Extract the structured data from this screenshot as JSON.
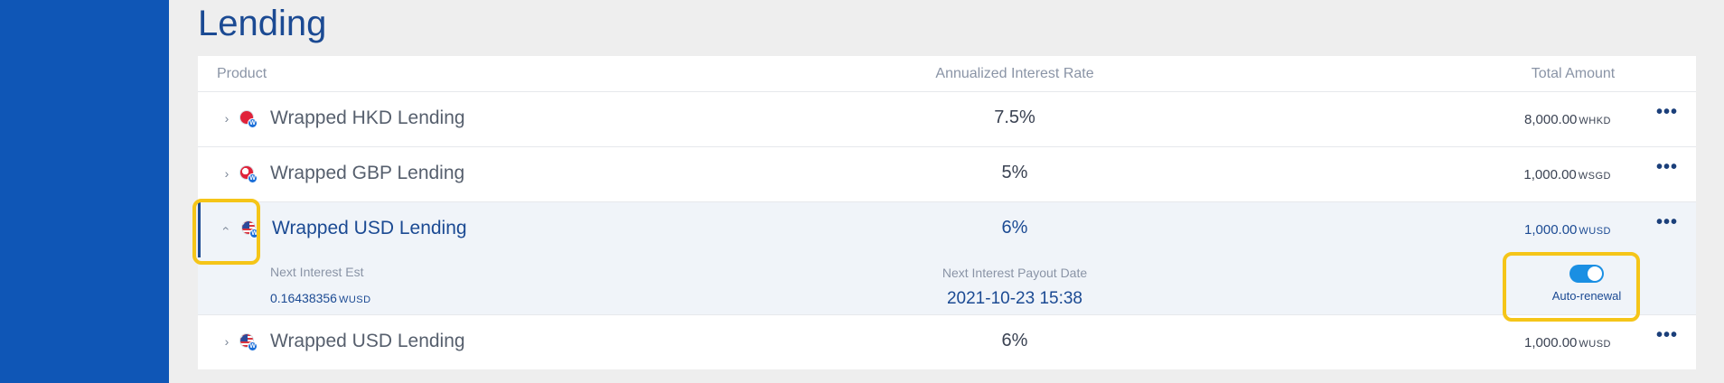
{
  "page": {
    "title": "Lending"
  },
  "table": {
    "headers": {
      "product": "Product",
      "rate": "Annualized Interest Rate",
      "total": "Total Amount"
    },
    "rows": [
      {
        "product": "Wrapped HKD Lending",
        "rate": "7.5%",
        "amount": "8,000.00",
        "unit": "WHKD",
        "coin": "hkd-coin-icon",
        "expanded": false
      },
      {
        "product": "Wrapped GBP Lending",
        "rate": "5%",
        "amount": "1,000.00",
        "unit": "WSGD",
        "coin": "gbp-coin-icon",
        "expanded": false
      },
      {
        "product": "Wrapped USD Lending",
        "rate": "6%",
        "amount": "1,000.00",
        "unit": "WUSD",
        "coin": "usd-coin-icon",
        "expanded": true
      },
      {
        "product": "Wrapped USD Lending",
        "rate": "6%",
        "amount": "1,000.00",
        "unit": "WUSD",
        "coin": "usd-coin-icon",
        "expanded": false
      }
    ],
    "detail": {
      "next_interest_label": "Next Interest Est",
      "next_interest_value": "0.16438356",
      "next_interest_unit": "WUSD",
      "payout_label": "Next Interest Payout Date",
      "payout_value": "2021-10-23 15:38",
      "auto_renewal_label": "Auto-renewal",
      "auto_renewal_on": true
    }
  },
  "icons": {
    "chevron_collapsed": "›",
    "chevron_expanded": "‹",
    "more": "•••",
    "coin_badge": "W"
  },
  "colors": {
    "sidebar": "#0f56b6",
    "accent": "#1b4a93",
    "toggle_on": "#1a8fe3",
    "highlight": "#f5c518"
  }
}
